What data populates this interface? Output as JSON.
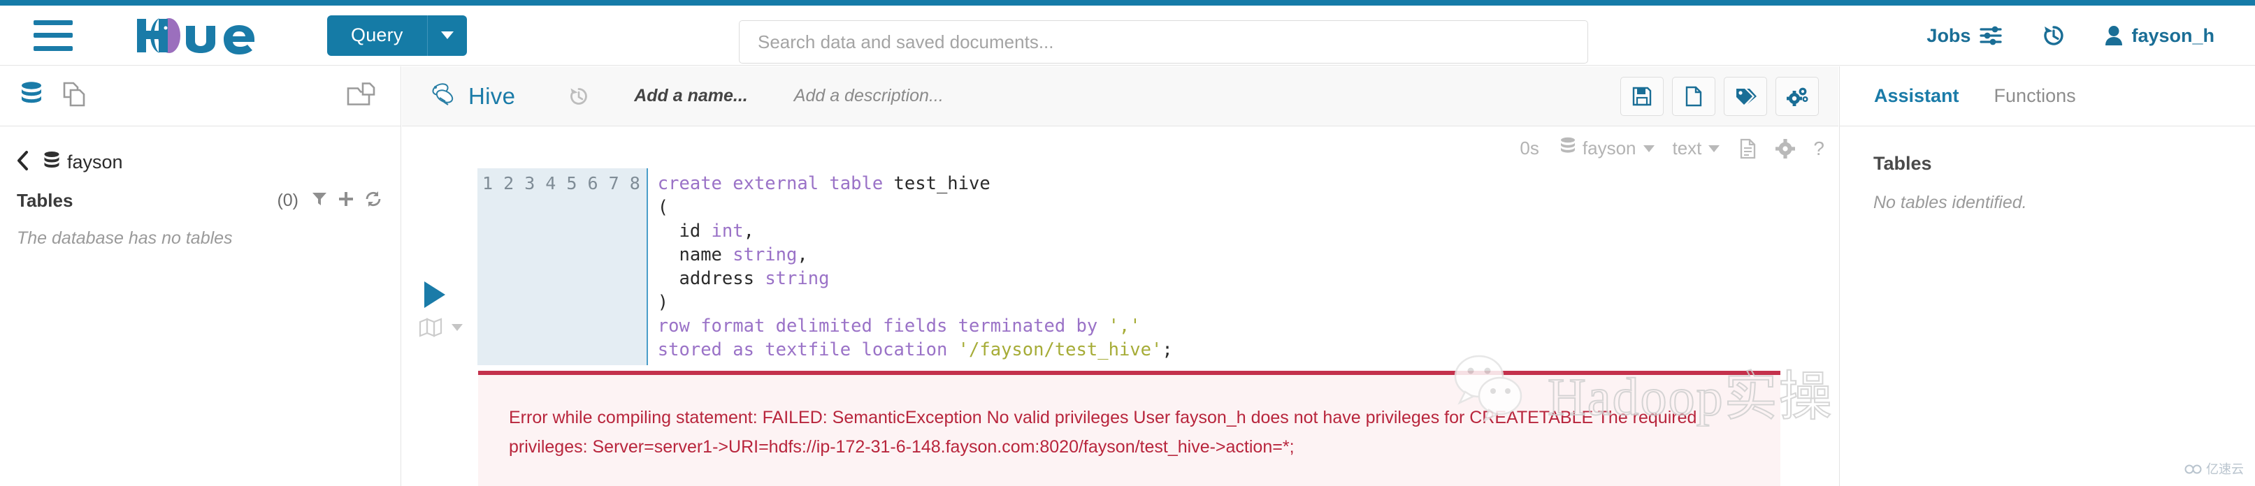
{
  "header": {
    "menu_icon": "hamburger-icon",
    "logo_text": "Hue",
    "query_button": {
      "label": "Query",
      "caret": "chevron-down-icon"
    },
    "search": {
      "placeholder": "Search data and saved documents...",
      "value": ""
    },
    "jobs": {
      "label": "Jobs",
      "icon": "sliders-icon"
    },
    "history_icon": "history-icon",
    "user": {
      "name": "fayson_h",
      "icon": "user-icon"
    }
  },
  "left_toolbar": {
    "db_icon": "database-icon",
    "documents_icon": "documents-icon",
    "open_folder_icon": "open-folder-icon"
  },
  "sidebar": {
    "back_icon": "chevron-left-icon",
    "database_icon": "database-icon",
    "database_name": "fayson",
    "tables_label": "Tables",
    "tables_count": "(0)",
    "filter_icon": "filter-icon",
    "add_icon": "plus-icon",
    "refresh_icon": "refresh-icon",
    "empty_message": "The database has no tables"
  },
  "editor_bar": {
    "engine_icon": "hive-bee-icon",
    "engine_name": "Hive",
    "undo_icon": "history-icon",
    "name_placeholder": "Add a name...",
    "description_placeholder": "Add a description...",
    "actions": [
      {
        "name": "save-button",
        "icon": "floppy-disk-icon"
      },
      {
        "name": "new-document-button",
        "icon": "file-icon"
      },
      {
        "name": "tags-button",
        "icon": "tags-icon"
      },
      {
        "name": "settings-button",
        "icon": "gears-icon"
      }
    ]
  },
  "exec_bar": {
    "elapsed": "0s",
    "database_icon": "database-icon",
    "database": "fayson",
    "format": "text",
    "log_icon": "file-lines-icon",
    "settings_icon": "gear-icon",
    "help_icon": "question-mark-icon"
  },
  "gutter": {
    "run_icon": "play-triangle-icon",
    "explain_icon": "map-icon",
    "explain_caret": "caret-down-icon"
  },
  "code": {
    "line_numbers": [
      "1",
      "2",
      "3",
      "4",
      "5",
      "6",
      "7",
      "8"
    ],
    "lines": [
      [
        {
          "t": "create external table ",
          "c": "kw"
        },
        {
          "t": "test_hive",
          "c": "ident"
        }
      ],
      [
        {
          "t": "(",
          "c": "punc"
        }
      ],
      [
        {
          "t": "  id ",
          "c": "ident"
        },
        {
          "t": "int",
          "c": "typ"
        },
        {
          "t": ",",
          "c": "punc"
        }
      ],
      [
        {
          "t": "  name ",
          "c": "ident"
        },
        {
          "t": "string",
          "c": "typ"
        },
        {
          "t": ",",
          "c": "punc"
        }
      ],
      [
        {
          "t": "  address ",
          "c": "ident"
        },
        {
          "t": "string",
          "c": "typ"
        }
      ],
      [
        {
          "t": ")",
          "c": "punc"
        }
      ],
      [
        {
          "t": "row format delimited fields terminated by ",
          "c": "kw"
        },
        {
          "t": "','",
          "c": "str"
        }
      ],
      [
        {
          "t": "stored as textfile location ",
          "c": "kw"
        },
        {
          "t": "'/fayson/test_hive'",
          "c": "str"
        },
        {
          "t": ";",
          "c": "punc"
        }
      ]
    ],
    "plain_text": "create external table test_hive\n(\n  id int,\n  name string,\n  address string\n)\nrow format delimited fields terminated by ','\nstored as textfile location '/fayson/test_hive';"
  },
  "error": {
    "message": "Error while compiling statement: FAILED: SemanticException No valid privileges User fayson_h does not have privileges for CREATETABLE The required privileges: Server=server1->URI=hdfs://ip-172-31-6-148.fayson.com:8020/fayson/test_hive->action=*;"
  },
  "assistant": {
    "tab_assistant": "Assistant",
    "tab_functions": "Functions",
    "tables_heading": "Tables",
    "empty_message": "No tables identified."
  },
  "watermark": {
    "icon": "wechat-icon",
    "text": "Hadoop实操",
    "badge": "亿速云"
  },
  "colors": {
    "accent": "#167ba8",
    "brand": "#157ba6",
    "error": "#b8253c",
    "error_border": "#c4314c",
    "error_bg": "#fdf3f4",
    "keyword": "#9a72c7",
    "string": "#a6ac37",
    "gutter_bg": "#e4edf3",
    "gutter_border": "#4a9ec9"
  }
}
